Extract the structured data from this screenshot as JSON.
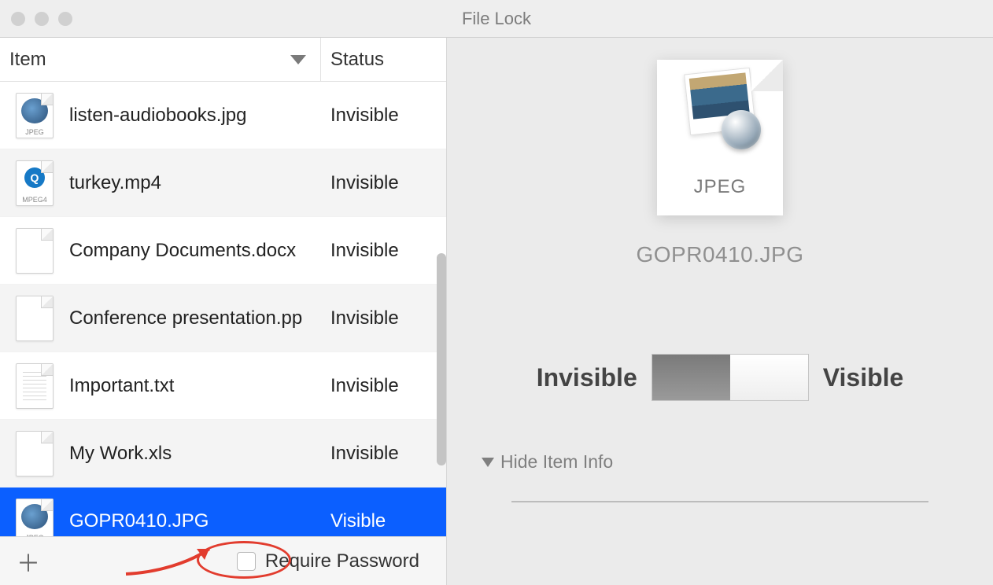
{
  "window": {
    "title": "File Lock"
  },
  "columns": {
    "item": "Item",
    "status": "Status"
  },
  "files": [
    {
      "name": "listen-audiobooks.jpg",
      "status": "Invisible",
      "type": "jpeg",
      "ext": "JPEG"
    },
    {
      "name": "turkey.mp4",
      "status": "Invisible",
      "type": "mpeg4",
      "ext": "MPEG4"
    },
    {
      "name": "Company Documents.docx",
      "status": "Invisible",
      "type": "doc",
      "ext": ""
    },
    {
      "name": "Conference presentation.pp",
      "status": "Invisible",
      "type": "doc",
      "ext": ""
    },
    {
      "name": "Important.txt",
      "status": "Invisible",
      "type": "txt",
      "ext": ""
    },
    {
      "name": "My Work.xls",
      "status": "Invisible",
      "type": "doc",
      "ext": ""
    },
    {
      "name": "GOPR0410.JPG",
      "status": "Visible",
      "type": "jpeg",
      "ext": "JPEG",
      "selected": true
    }
  ],
  "bottombar": {
    "require_password_label": "Require Password"
  },
  "preview": {
    "type_label": "JPEG",
    "filename": "GOPR0410.JPG",
    "toggle_left": "Invisible",
    "toggle_right": "Visible",
    "hide_item_info": "Hide Item Info"
  }
}
